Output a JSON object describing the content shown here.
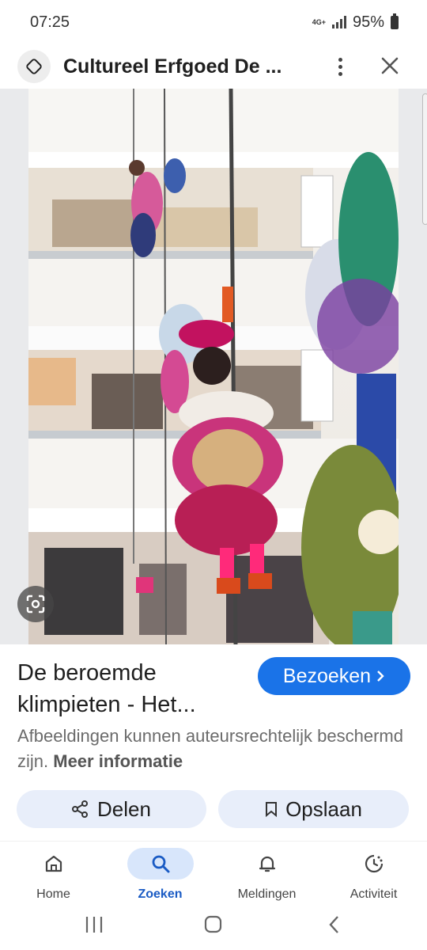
{
  "status": {
    "time": "07:25",
    "network": "4G+",
    "battery": "95%"
  },
  "header": {
    "title": "Cultureel Erfgoed De ...",
    "more_icon": "more-vert-icon",
    "close_icon": "close-icon"
  },
  "result": {
    "title": "De beroemde klimpieten - Het...",
    "visit_label": "Bezoeken",
    "disclaimer": "Afbeeldingen kunnen auteursrechtelijk beschermd zijn.",
    "more_info": "Meer informatie"
  },
  "actions": {
    "share_label": "Delen",
    "save_label": "Opslaan"
  },
  "nav": {
    "items": [
      {
        "label": "Home",
        "icon": "home-icon",
        "active": false
      },
      {
        "label": "Zoeken",
        "icon": "search-icon",
        "active": true
      },
      {
        "label": "Meldingen",
        "icon": "bell-icon",
        "active": false
      },
      {
        "label": "Activiteit",
        "icon": "activity-icon",
        "active": false
      }
    ]
  },
  "colors": {
    "accent": "#1a73e8",
    "active_nav_bg": "#d8e6fb",
    "button_bg": "#e8eefa"
  }
}
